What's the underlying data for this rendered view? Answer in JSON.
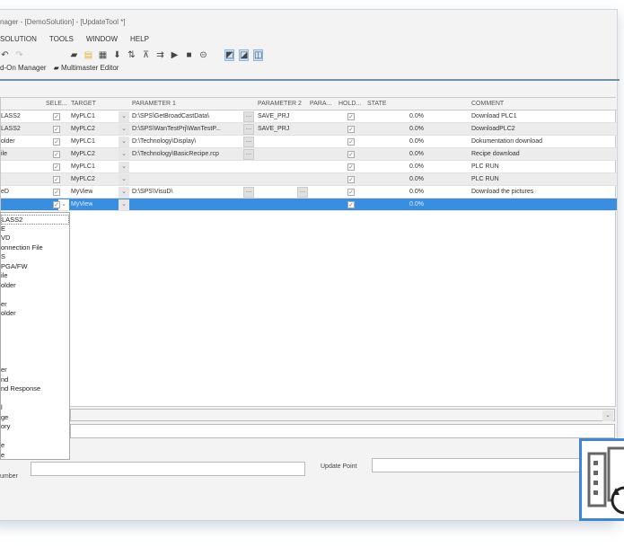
{
  "window": {
    "title": "nager - [DemoSolution] - [UpdateTool *]"
  },
  "menu": [
    "SOLUTION",
    "TOOLS",
    "WINDOW",
    "HELP"
  ],
  "toolbar": {
    "icons": [
      "undo-icon",
      "redo-icon",
      "save-icon",
      "open-icon",
      "calendar-icon",
      "download-icon",
      "transfer-icon",
      "upload-icon",
      "export-icon",
      "play-icon",
      "stop-icon",
      "link-icon",
      "view1-icon",
      "view2-icon",
      "view3-icon"
    ]
  },
  "toolbar2": {
    "addon": "d-On Manager",
    "multimaster": "Multimaster Editor"
  },
  "table": {
    "headers": [
      "",
      "SELE...",
      "TARGET",
      "PARAMETER 1",
      "PARAMETER 2",
      "PARA...",
      "HOLD...",
      "STATE",
      "COMMENT"
    ],
    "rows": [
      {
        "type": "LASS2",
        "target": "MyPLC1",
        "p1": "D:\\SPS\\GetBroadCastData\\",
        "p2": "SAVE_PRJ",
        "state": "0.0%",
        "comment": "Download PLC1"
      },
      {
        "type": "LASS2",
        "target": "MyPLC2",
        "p1": "D:\\SPS\\WanTestPrj\\WanTestP...",
        "p2": "SAVE_PRJ",
        "state": "0.0%",
        "comment": "DownloadPLC2"
      },
      {
        "type": "older",
        "target": "MyPLC1",
        "p1": "D:\\Technology\\Display\\",
        "p2": "",
        "state": "0.0%",
        "comment": "Dokumentation download"
      },
      {
        "type": "ile",
        "target": "MyPLC2",
        "p1": "D:\\Technology\\BasicRecipe.rcp",
        "p2": "",
        "state": "0.0%",
        "comment": "Recipe download"
      },
      {
        "type": "",
        "target": "MyPLC1",
        "p1": "",
        "p2": "",
        "state": "0.0%",
        "comment": "PLC RUN"
      },
      {
        "type": "",
        "target": "MyPLC2",
        "p1": "",
        "p2": "",
        "state": "0.0%",
        "comment": "PLC RUN"
      },
      {
        "type": "eD",
        "target": "MyView",
        "p1": "D:\\SPS\\VisuD\\",
        "p2": "",
        "state": "0.0%",
        "comment": "Download the pictures"
      },
      {
        "type": "",
        "target": "MyView",
        "p1": "",
        "p2": "",
        "state": "0.0%",
        "comment": ""
      }
    ]
  },
  "dropdown": [
    "LASS2",
    "E",
    "VD",
    "onnection File",
    "S",
    "PGA/FW",
    "ile",
    "older",
    "",
    "er",
    "older",
    "",
    "",
    "",
    "",
    "",
    "er",
    "nd",
    "nd Response",
    "",
    "l",
    "ge",
    "ory",
    "",
    "e",
    "e"
  ],
  "bottom": {
    "number_label": "umber",
    "update_point_label": "Update Point",
    "number_value": "",
    "update_point_value": ""
  }
}
